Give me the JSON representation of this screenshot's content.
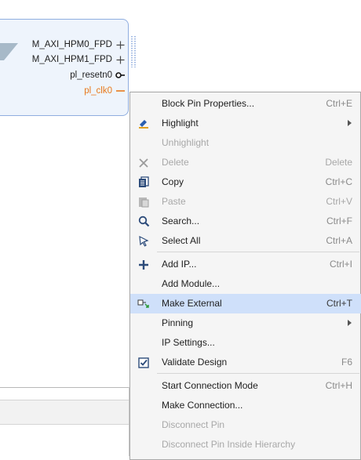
{
  "block": {
    "pins": [
      {
        "label": "M_AXI_HPM0_FPD",
        "glyph": "plus-icon",
        "color": "#1e1e1e"
      },
      {
        "label": "M_AXI_HPM1_FPD",
        "glyph": "plus-icon",
        "color": "#1e1e1e"
      },
      {
        "label": "pl_resetn0",
        "glyph": "reset-pin-icon",
        "color": "#1e1e1e"
      },
      {
        "label": "pl_clk0",
        "glyph": "clock-pin-icon",
        "color": "#e87a1e"
      }
    ]
  },
  "menu": {
    "items": [
      {
        "label": "Block Pin Properties...",
        "shortcut": "Ctrl+E",
        "icon": "",
        "enabled": true
      },
      {
        "label": "Highlight",
        "shortcut": "",
        "icon": "highlight-icon",
        "enabled": true,
        "submenu": true
      },
      {
        "label": "Unhighlight",
        "shortcut": "",
        "icon": "",
        "enabled": false
      },
      {
        "label": "Delete",
        "shortcut": "Delete",
        "icon": "delete-icon",
        "enabled": false
      },
      {
        "label": "Copy",
        "shortcut": "Ctrl+C",
        "icon": "copy-icon",
        "enabled": true
      },
      {
        "label": "Paste",
        "shortcut": "Ctrl+V",
        "icon": "paste-icon",
        "enabled": false
      },
      {
        "label": "Search...",
        "shortcut": "Ctrl+F",
        "icon": "search-icon",
        "enabled": true
      },
      {
        "label": "Select All",
        "shortcut": "Ctrl+A",
        "icon": "select-all-icon",
        "enabled": true
      },
      {
        "label": "Add IP...",
        "shortcut": "Ctrl+I",
        "icon": "add-icon",
        "enabled": true
      },
      {
        "label": "Add Module...",
        "shortcut": "",
        "icon": "",
        "enabled": true
      },
      {
        "label": "Make External",
        "shortcut": "Ctrl+T",
        "icon": "make-external-icon",
        "enabled": true,
        "highlighted": true
      },
      {
        "label": "Pinning",
        "shortcut": "",
        "icon": "",
        "enabled": true,
        "submenu": true
      },
      {
        "label": "IP Settings...",
        "shortcut": "",
        "icon": "",
        "enabled": true
      },
      {
        "label": "Validate Design",
        "shortcut": "F6",
        "icon": "validate-icon",
        "enabled": true
      },
      {
        "label": "Start Connection Mode",
        "shortcut": "Ctrl+H",
        "icon": "",
        "enabled": true
      },
      {
        "label": "Make Connection...",
        "shortcut": "",
        "icon": "",
        "enabled": true
      },
      {
        "label": "Disconnect Pin",
        "shortcut": "",
        "icon": "",
        "enabled": false
      },
      {
        "label": "Disconnect Pin Inside Hierarchy",
        "shortcut": "",
        "icon": "",
        "enabled": false
      }
    ]
  },
  "colors": {
    "menu_highlight": "#cfe0fa",
    "block_fill": "#eef4fc",
    "block_border": "#90aee0",
    "clock_pin": "#e87a1e",
    "disabled_text": "#a8a8a8"
  }
}
